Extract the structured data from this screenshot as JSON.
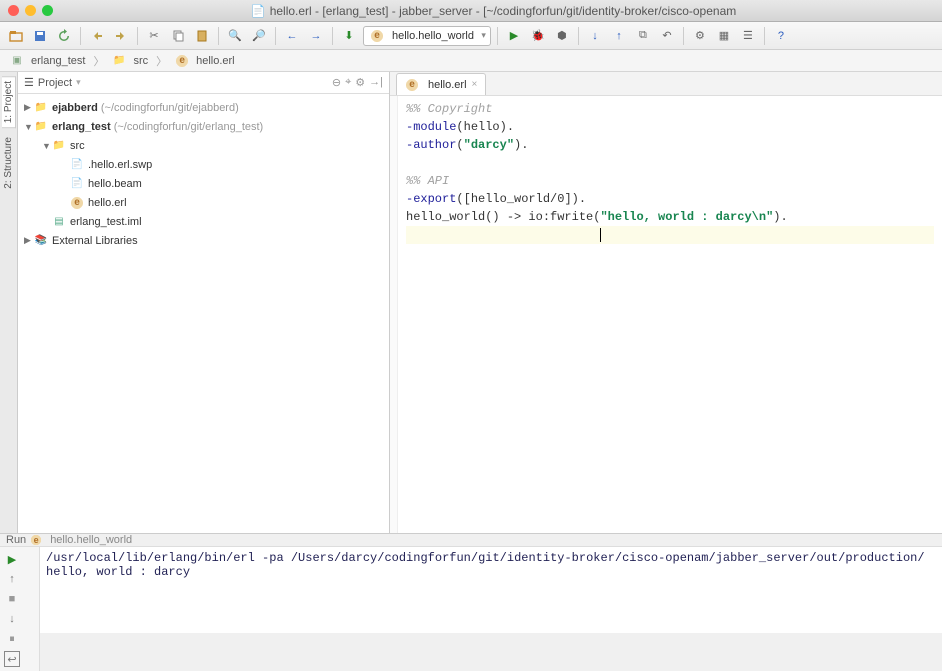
{
  "window": {
    "title": "hello.erl - [erlang_test] - jabber_server - [~/codingforfun/git/identity-broker/cisco-openam"
  },
  "run_config": "hello.hello_world",
  "breadcrumbs": [
    {
      "label": "erlang_test",
      "icon": "module"
    },
    {
      "label": "src",
      "icon": "folder"
    },
    {
      "label": "hello.erl",
      "icon": "erl"
    }
  ],
  "sidebar_tabs": [
    "1: Project",
    "2: Structure"
  ],
  "project_panel": {
    "title": "Project"
  },
  "tree": {
    "ejabberd": {
      "name": "ejabberd",
      "path": "(~/codingforfun/git/ejabberd)"
    },
    "erlang_test": {
      "name": "erlang_test",
      "path": "(~/codingforfun/git/erlang_test)"
    },
    "src": "src",
    "f1": ".hello.erl.swp",
    "f2": "hello.beam",
    "f3": "hello.erl",
    "iml": "erlang_test.iml",
    "ext": "External Libraries"
  },
  "editor_tab": "hello.erl",
  "code": {
    "c1": "%% Copyright",
    "kw_module": "-module",
    "mod_atom": "(hello).",
    "kw_author": "-author",
    "author_str": "\"darcy\"",
    "c2": "%% API",
    "kw_export": "-export",
    "export_body": "([hello_world/0]).",
    "fn_line_a": "hello_world() -> io:fwrite(",
    "fn_str": "\"hello, world : darcy\\n\"",
    "fn_line_b": ")."
  },
  "run": {
    "title": "Run",
    "config": "hello.hello_world",
    "line1": "/usr/local/lib/erlang/bin/erl -pa /Users/darcy/codingforfun/git/identity-broker/cisco-openam/jabber_server/out/production/",
    "line2": "hello, world : darcy"
  }
}
